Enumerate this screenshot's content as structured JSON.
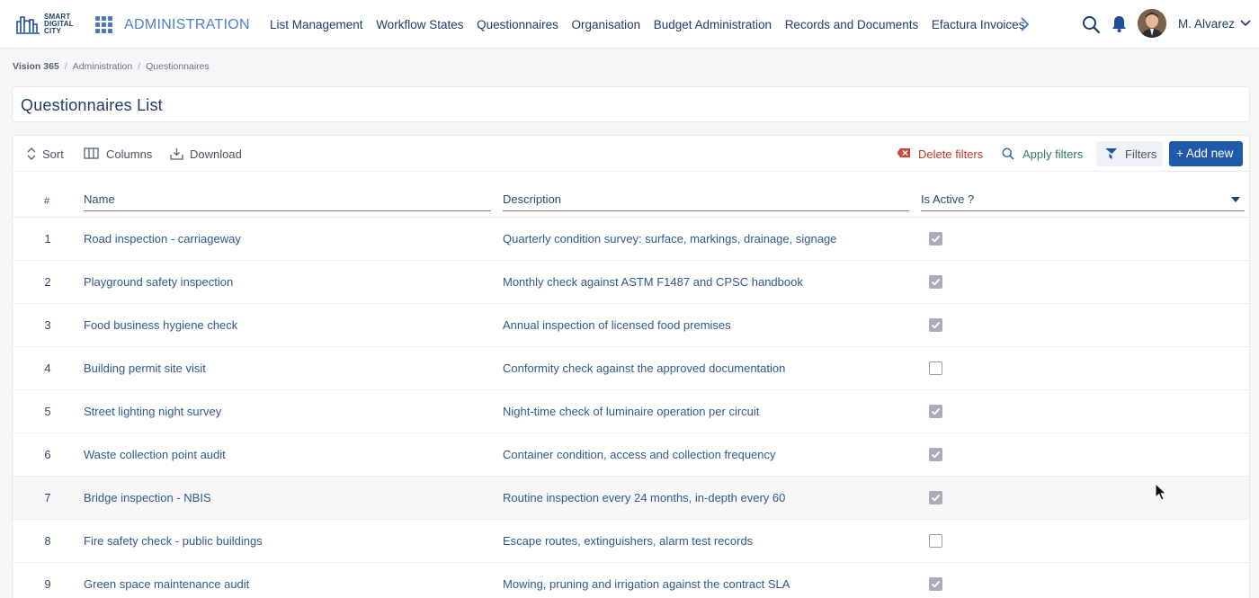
{
  "brand": {
    "logo_line1": "SMART",
    "logo_line2": "DIGITAL",
    "logo_line3": "CITY",
    "module": "ADMINISTRATION"
  },
  "nav": {
    "items": [
      "List Management",
      "Workflow States",
      "Questionnaires",
      "Organisation",
      "Budget Administration",
      "Records and Documents",
      "Efactura Invoices"
    ]
  },
  "user": {
    "name": "M. Alvarez"
  },
  "breadcrumb": [
    "Vision 365",
    "Administration",
    "Questionnaires"
  ],
  "page": {
    "title": "Questionnaires List"
  },
  "toolbar": {
    "sort": "Sort",
    "columns": "Columns",
    "download": "Download",
    "delete_filters": "Delete filters",
    "apply_filters": "Apply filters",
    "filters": "Filters",
    "add_new": "+ Add new"
  },
  "table": {
    "headers": {
      "num": "#",
      "name": "Name",
      "description": "Description",
      "active": "Is Active ?"
    },
    "rows": [
      {
        "num": "1",
        "name": "Road inspection - carriageway",
        "description": "Quarterly condition survey: surface, markings, drainage, signage",
        "active": true
      },
      {
        "num": "2",
        "name": "Playground safety inspection",
        "description": "Monthly check against ASTM F1487 and CPSC handbook",
        "active": true
      },
      {
        "num": "3",
        "name": "Food business hygiene check",
        "description": "Annual inspection of licensed food premises",
        "active": true
      },
      {
        "num": "4",
        "name": "Building permit site visit",
        "description": "Conformity check against the approved documentation",
        "active": false
      },
      {
        "num": "5",
        "name": "Street lighting night survey",
        "description": "Night-time check of luminaire operation per circuit",
        "active": true
      },
      {
        "num": "6",
        "name": "Waste collection point audit",
        "description": "Container condition, access and collection frequency",
        "active": true
      },
      {
        "num": "7",
        "name": "Bridge inspection - NBIS",
        "description": "Routine inspection every 24 months, in-depth every 60",
        "active": true,
        "highlighted": true
      },
      {
        "num": "8",
        "name": "Fire safety check - public buildings",
        "description": "Escape routes, extinguishers, alarm test records",
        "active": false
      },
      {
        "num": "9",
        "name": "Green space maintenance audit",
        "description": "Mowing, pruning and irrigation against the contract SLA",
        "active": true
      }
    ]
  },
  "colors": {
    "primary": "#1e5aa8",
    "accent": "#4f7fc9",
    "danger": "#c0392b",
    "success_text": "#2e7d5b"
  }
}
